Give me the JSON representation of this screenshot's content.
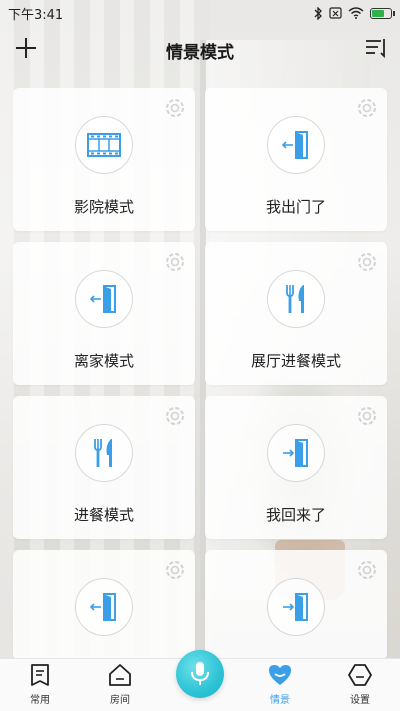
{
  "status_bar": {
    "time": "下午3:41",
    "icons": [
      "bluetooth-icon",
      "sim-icon",
      "wifi-icon",
      "battery-icon"
    ],
    "battery_level": 0.6
  },
  "header": {
    "title": "情景模式",
    "add_icon": "plus-icon",
    "sort_icon": "sort-icon"
  },
  "scenes": [
    {
      "label": "影院模式",
      "icon": "film-icon"
    },
    {
      "label": "我出门了",
      "icon": "door-exit-icon"
    },
    {
      "label": "离家模式",
      "icon": "door-exit-icon"
    },
    {
      "label": "展厅进餐模式",
      "icon": "cutlery-icon"
    },
    {
      "label": "进餐模式",
      "icon": "cutlery-icon"
    },
    {
      "label": "我回来了",
      "icon": "door-enter-icon"
    },
    {
      "label": "",
      "icon": "door-exit-icon"
    },
    {
      "label": "",
      "icon": "door-enter-icon"
    }
  ],
  "tabs": [
    {
      "label": "常用",
      "icon": "bookmark-icon"
    },
    {
      "label": "房间",
      "icon": "house-icon"
    },
    {
      "label": "情景",
      "icon": "heart-icon",
      "active": true
    },
    {
      "label": "设置",
      "icon": "settings-icon"
    }
  ],
  "colors": {
    "accent": "#3a9ee8",
    "mic": "#2cc3d5"
  }
}
